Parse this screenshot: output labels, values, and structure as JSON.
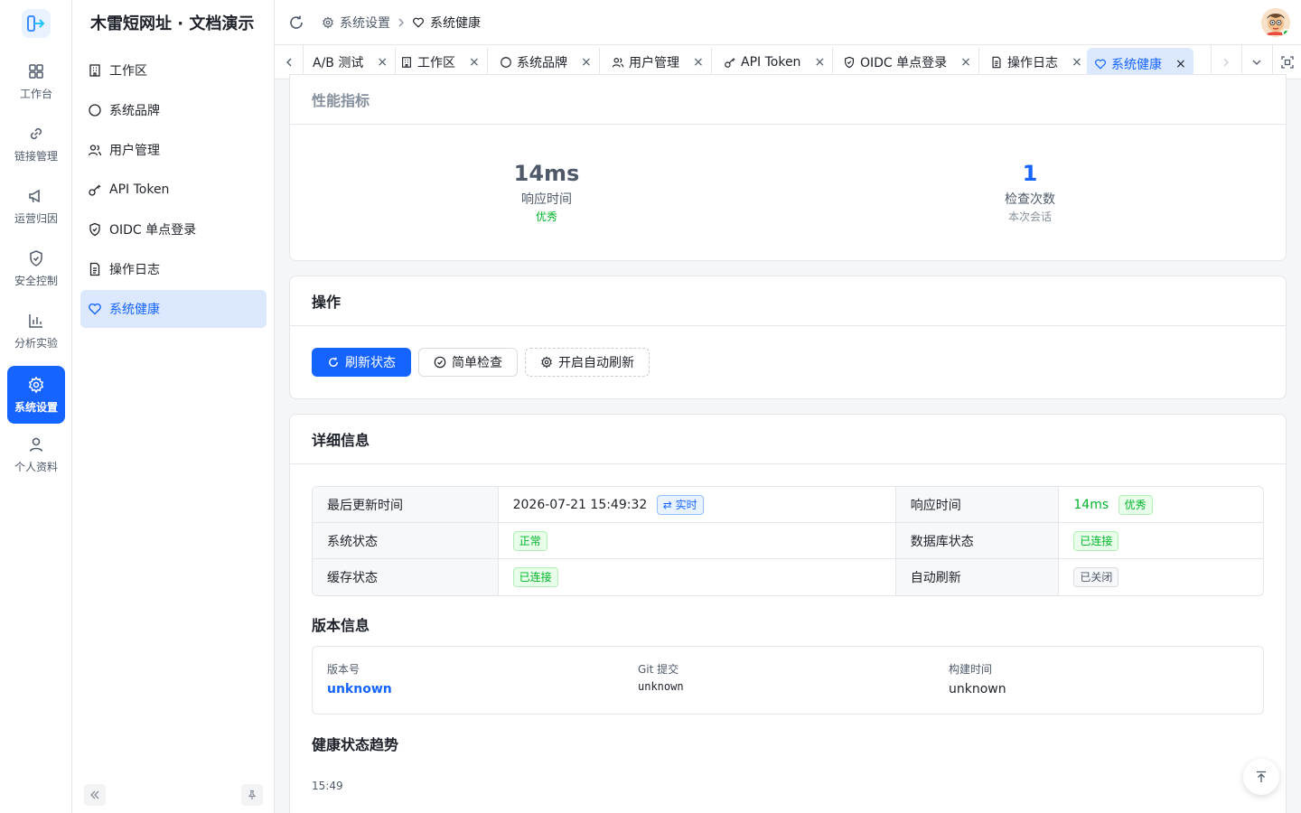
{
  "app": {
    "brand": "木雷短网址 · 文档演示"
  },
  "rail": {
    "items": [
      {
        "label": "工作台",
        "icon": "dashboard-icon"
      },
      {
        "label": "链接管理",
        "icon": "link-icon"
      },
      {
        "label": "运营归因",
        "icon": "megaphone-icon"
      },
      {
        "label": "安全控制",
        "icon": "shield-icon"
      },
      {
        "label": "分析实验",
        "icon": "bar-chart-icon"
      },
      {
        "label": "系统设置",
        "icon": "gear-icon",
        "active": true
      },
      {
        "label": "个人资料",
        "icon": "user-icon"
      }
    ]
  },
  "sidebar": {
    "items": [
      {
        "label": "工作区",
        "icon": "building-icon"
      },
      {
        "label": "系统品牌",
        "icon": "circle-icon"
      },
      {
        "label": "用户管理",
        "icon": "users-icon"
      },
      {
        "label": "API Token",
        "icon": "key-icon"
      },
      {
        "label": "OIDC 单点登录",
        "icon": "shield-check-icon"
      },
      {
        "label": "操作日志",
        "icon": "file-text-icon"
      },
      {
        "label": "系统健康",
        "icon": "heart-icon",
        "active": true
      }
    ]
  },
  "header": {
    "breadcrumb": {
      "parent": "系统设置",
      "current": "系统健康"
    }
  },
  "tabs": [
    {
      "label": "A/B 测试"
    },
    {
      "label": "工作区"
    },
    {
      "label": "系统品牌"
    },
    {
      "label": "用户管理"
    },
    {
      "label": "API Token"
    },
    {
      "label": "OIDC 单点登录"
    },
    {
      "label": "操作日志"
    },
    {
      "label": "系统健康",
      "active": true
    }
  ],
  "tab_close_glyph": "×",
  "performance": {
    "title": "性能指标",
    "response": {
      "value": "14ms",
      "label": "响应时间",
      "sub": "优秀"
    },
    "checks": {
      "value": "1",
      "label": "检查次数",
      "sub": "本次会话"
    }
  },
  "actions": {
    "title": "操作",
    "refresh": "刷新状态",
    "simple_check": "简单检查",
    "auto_refresh": "开启自动刷新"
  },
  "details": {
    "title": "详细信息",
    "last_update_label": "最后更新时间",
    "last_update_value": "2026-07-21 15:49:32",
    "realtime_tag": "⇄ 实时",
    "response_label": "响应时间",
    "response_value": "14ms",
    "response_tag": "优秀",
    "system_status_label": "系统状态",
    "system_status_value": "正常",
    "db_status_label": "数据库状态",
    "db_status_value": "已连接",
    "cache_status_label": "缓存状态",
    "cache_status_value": "已连接",
    "auto_refresh_label": "自动刷新",
    "auto_refresh_value": "已关闭"
  },
  "version": {
    "title": "版本信息",
    "version_label": "版本号",
    "version_value": "unknown",
    "git_label": "Git 提交",
    "git_value": "unknown",
    "build_label": "构建时间",
    "build_value": "unknown"
  },
  "trend": {
    "title": "健康状态趋势",
    "time": "15:49"
  },
  "colors": {
    "accent": "#1664ff",
    "success": "#00b42a"
  }
}
